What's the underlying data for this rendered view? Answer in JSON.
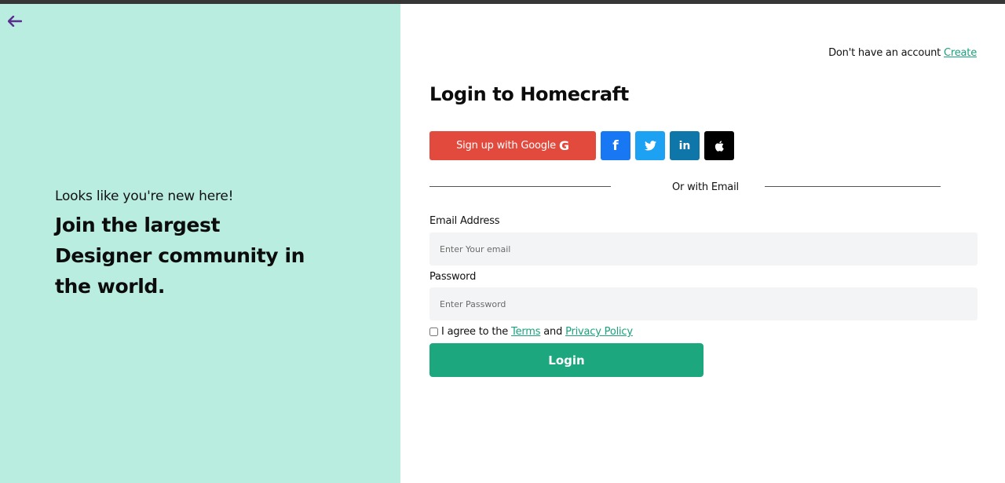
{
  "left": {
    "subtitle": "Looks like you're new here!",
    "headline": "Join the largest Designer community in the world."
  },
  "header": {
    "account_text": "Don't have an account",
    "create_link": "Create"
  },
  "form": {
    "title": "Login to Homecraft",
    "google_label": "Sign up with Google",
    "google_glyph": "G",
    "facebook_glyph": "f",
    "twitter_glyph": "🐦",
    "linkedin_glyph": "in",
    "apple_glyph": "",
    "divider_text": "Or with Email",
    "email_label": "Email Address",
    "email_placeholder": "Enter Your email",
    "password_label": "Password",
    "password_placeholder": "Enter Password",
    "agree_prefix": "I agree to the",
    "terms_link": "Terms",
    "and_text": "and",
    "privacy_link": "Privacy Policy",
    "login_label": "Login"
  },
  "colors": {
    "accent": "#1ca77e",
    "left_bg": "#b8ede0",
    "google": "#e14a3c",
    "facebook": "#1877f2",
    "twitter": "#1da1f2",
    "linkedin": "#0e76a8",
    "apple": "#000000",
    "back_arrow": "#5b2d8e"
  },
  "icons": {
    "back": "arrow-left-icon",
    "google": "google-icon",
    "facebook": "facebook-icon",
    "twitter": "twitter-icon",
    "linkedin": "linkedin-icon",
    "apple": "apple-icon"
  }
}
